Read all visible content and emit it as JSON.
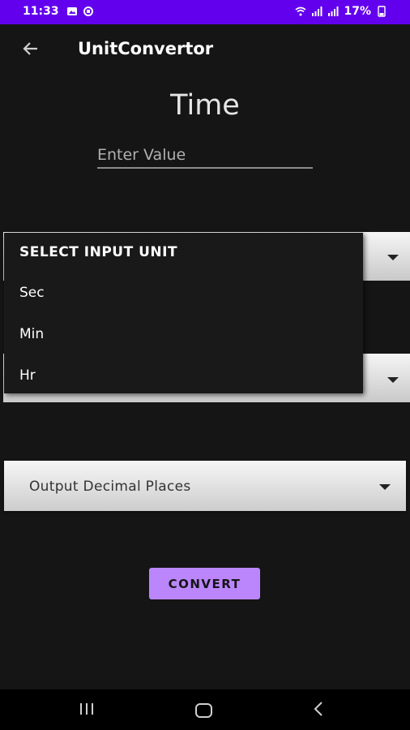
{
  "status_bar": {
    "time": "11:33",
    "battery": "17%",
    "background_color": "#6200ee"
  },
  "app_bar": {
    "title": "UnitConvertor"
  },
  "screen": {
    "title": "Time",
    "input_placeholder": "Enter Value"
  },
  "input_unit_dropdown": {
    "header": "SELECT INPUT UNIT",
    "options": [
      "Sec",
      "Min",
      "Hr"
    ]
  },
  "decimal_places": {
    "label": "Output Decimal Places"
  },
  "convert_button": {
    "label": "CONVERT",
    "color": "#bb86fc"
  },
  "nav_bar": {
    "icons": [
      "recents-icon",
      "home-icon",
      "back-icon"
    ]
  }
}
